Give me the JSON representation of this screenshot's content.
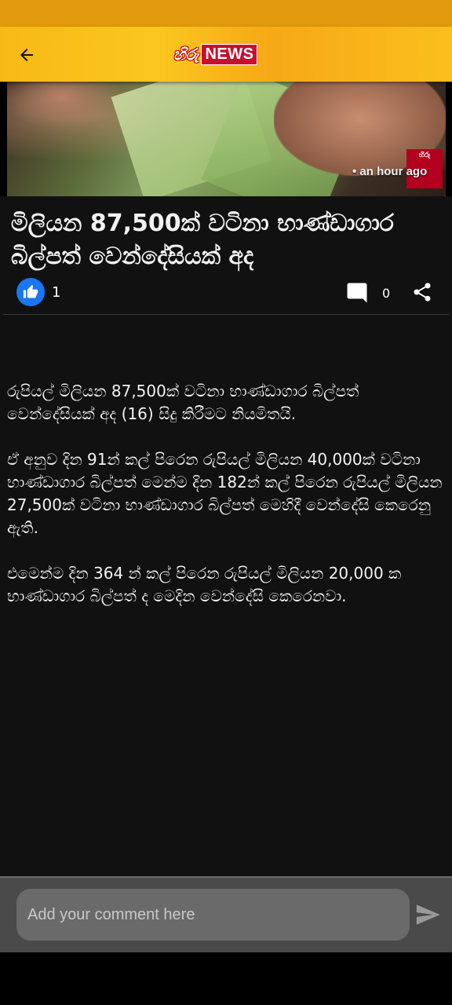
{
  "app": {
    "logo_hiru": "හිරු",
    "logo_news": "NEWS"
  },
  "hero": {
    "time_ago": "• an hour ago",
    "badge_text": "හිරු"
  },
  "article": {
    "title": "මිලියන 87,500ක් වටිනා භාණ්ඩාගාර බිල්පත් වෙන්දේසියක් අද",
    "likes": "1",
    "comments": "0",
    "paragraphs": [
      "රුපියල් මිලියන 87,500ක් වටිනා භාණ්ඩාගාර බිල්පත් වෙන්දේසියක් අද (16) සිදු කිරීමට නියමිතයි.",
      "ඒ අනුව දින 91න් කල් පිරෙන රුපියල් මිලියන 40,000ක් වටිනා භාණ්ඩාගාර බිල්පත් මෙන්ම දින 182න් කල් පිරෙන රුපියල් මිලියන 27,500ක් වටිනා භාණ්ඩාගාර බිල්පත් මෙහිදී වෙන්දේසි කෙරෙනු ඇති.",
      "එමෙන්ම දින 364 න් කල් පිරෙන රුපියල් මිලියන 20,000 ක භාණ්ඩාගාර බිල්පත් ද මෙදින වෙන්දේසි කෙරෙනවා."
    ]
  },
  "comment_box": {
    "placeholder": "Add your comment here",
    "value": ""
  },
  "colors": {
    "app_bar": "#f7b916",
    "status_bar": "#e09a0c",
    "like_button": "#1877f2",
    "background": "#111111"
  },
  "icons": {
    "back": "arrow-left-icon",
    "like": "thumbs-up-icon",
    "comment": "comment-bubble-icon",
    "share": "share-icon",
    "send": "send-icon"
  }
}
